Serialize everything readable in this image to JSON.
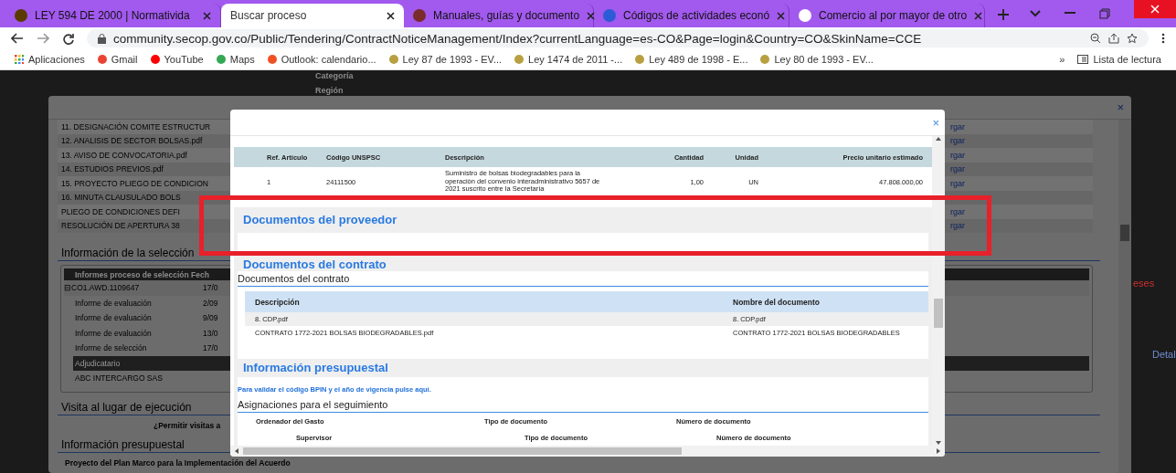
{
  "browser": {
    "tabs": [
      {
        "title": "LEY 594 DE 2000 | Normativida",
        "selected": false
      },
      {
        "title": "Buscar proceso",
        "selected": true
      },
      {
        "title": "Manuales, guías y documento",
        "selected": false
      },
      {
        "title": "Códigos de actividades econó",
        "selected": false
      },
      {
        "title": "Comercio al por mayor de otro",
        "selected": false
      }
    ],
    "url": "community.secop.gov.co/Public/Tendering/ContractNoticeManagement/Index?currentLanguage=es-CO&Page=login&Country=CO&SkinName=CCE",
    "bookmarks": [
      "Aplicaciones",
      "Gmail",
      "YouTube",
      "Maps",
      "Outlook: calendario...",
      "Ley 87 de 1993 - EV...",
      "Ley 1474 de 2011 -...",
      "Ley 489 de 1998 - E...",
      "Ley 80 de 1993 - EV..."
    ],
    "more_bookmarks": "»",
    "reading_list": "Lista de lectura"
  },
  "page": {
    "filters": [
      "Categoría",
      "Región"
    ],
    "side_fragments": [
      {
        "kind": "alert",
        "text": "eses"
      },
      {
        "kind": "link",
        "text": "Detal"
      }
    ]
  },
  "back_dialog": {
    "close": "×",
    "documents": [
      {
        "name": "11. DESIGNACIÓN COMITE ESTRUCTUR",
        "link": "rgar"
      },
      {
        "name": "12. ANALISIS DE SECTOR BOLSAS.pdf",
        "link": "rgar"
      },
      {
        "name": "13. AVISO DE CONVOCATORIA.pdf",
        "link": "rgar"
      },
      {
        "name": "14. ESTUDIOS PREVIOS.pdf",
        "link": "rgar"
      },
      {
        "name": "15. PROYECTO PLIEGO DE CONDICION",
        "link": "rgar"
      },
      {
        "name": "16. MINUTA CLAUSULADO BOLS"
      },
      {
        "name": "PLIEGO DE CONDICIONES DEFI",
        "link": "rgar"
      },
      {
        "name": "RESOLUCIÓN DE APERTURA 38",
        "link": "rgar"
      }
    ],
    "selection": {
      "title": "Información de la selección",
      "header": "Informes proceso de selección Fech",
      "rows": [
        {
          "kind": "group",
          "label": "⊟CO1.AWD.1109647",
          "date": "17/0"
        },
        {
          "kind": "item",
          "label": "Informe de evaluación",
          "date": "2/09"
        },
        {
          "kind": "item",
          "label": "Informe de evaluación",
          "date": "9/09"
        },
        {
          "kind": "item",
          "label": "Informe de evaluación",
          "date": "13/0"
        },
        {
          "kind": "item",
          "label": "Informe de selección",
          "date": "17/0"
        },
        {
          "kind": "band",
          "label": "Adjudicatario"
        },
        {
          "kind": "item",
          "label": "ABC INTERCARGO SAS"
        }
      ]
    },
    "visit": {
      "title": "Visita al lugar de ejecución",
      "question": "¿Permitir visitas a"
    },
    "budget": {
      "title": "Información presupuestal",
      "project": "Proyecto del Plan Marco para la Implementación del Acuerdo"
    }
  },
  "modal": {
    "close": "×",
    "items_table": {
      "columns": [
        "Ref. Artículo",
        "Código UNSPSC",
        "Descripción",
        "Cantidad",
        "Unidad",
        "Precio unitario estimado"
      ],
      "rows": [
        [
          "1",
          "24111500",
          "Suministro de bolsas biodegradables para la operación del convenio interadministrativo 5657 de 2021 suscrito entre la Secretaría",
          "1,00",
          "UN",
          "47.808.000,00"
        ]
      ]
    },
    "supplier_docs": {
      "title": "Documentos del proveedor"
    },
    "contract_docs": {
      "title": "Documentos del contrato",
      "subtitle": "Documentos del contrato",
      "columns": [
        "Descripción",
        "Nombre del documento"
      ],
      "rows": [
        [
          "8. CDP.pdf",
          "8. CDP.pdf"
        ],
        [
          "CONTRATO 1772-2021 BOLSAS BIODEGRADABLES.pdf",
          "CONTRATO 1772-2021 BOLSAS BIODEGRADABLES"
        ]
      ]
    },
    "budget": {
      "title": "Información presupuestal",
      "link": "Para validar el código BPIN y el año de vigencia pulse aquí.",
      "subtitle": "Asignaciones para el seguimiento",
      "rows": [
        [
          "Ordenador del Gasto",
          "Tipo de documento",
          "Número de documento"
        ],
        [
          "Supervisor",
          "Tipo de documento",
          "Número de documento"
        ]
      ]
    }
  }
}
